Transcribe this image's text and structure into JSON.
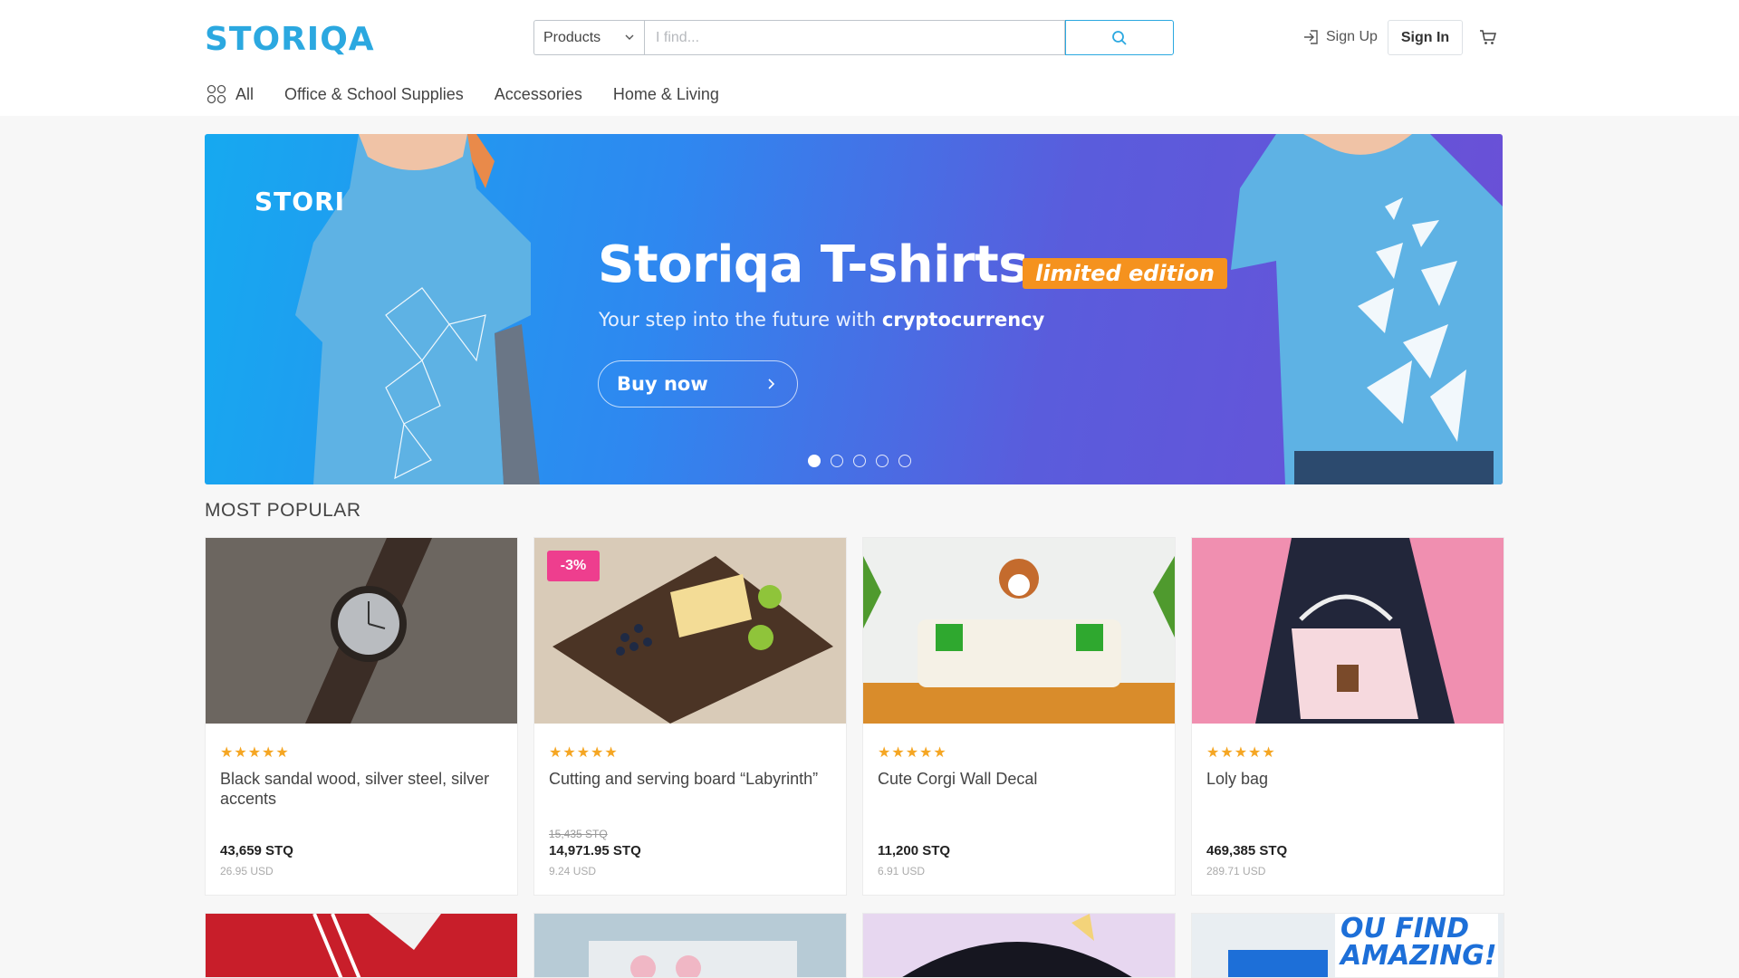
{
  "header": {
    "logo": "STORIQA",
    "search_category": "Products",
    "search_placeholder": "I find...",
    "signup_label": "Sign Up",
    "signin_label": "Sign In"
  },
  "nav": {
    "items": [
      {
        "label": "All"
      },
      {
        "label": "Office & School Supplies"
      },
      {
        "label": "Accessories"
      },
      {
        "label": "Home & Living"
      }
    ]
  },
  "banner": {
    "logo": "STORI",
    "title": "Storiqa T-shirts",
    "badge": "limited edition",
    "subtitle_prefix": "Your step into the future with ",
    "subtitle_bold": "cryptocurrency",
    "button_label": "Buy now",
    "slide_count": 5,
    "active_slide": 1
  },
  "section_title": "MOST POPULAR",
  "products": [
    {
      "title": "Black sandal wood, silver steel, silver accents",
      "stars": "★★★★★",
      "old_price": "",
      "price": "43,659 STQ",
      "usd": "26.95 USD",
      "discount": ""
    },
    {
      "title": "Cutting and serving board “Labyrinth”",
      "stars": "★★★★★",
      "old_price": "15,435 STQ",
      "price": "14,971.95 STQ",
      "usd": "9.24 USD",
      "discount": "-3%"
    },
    {
      "title": "Cute Corgi Wall Decal",
      "stars": "★★★★★",
      "old_price": "",
      "price": "11,200 STQ",
      "usd": "6.91 USD",
      "discount": ""
    },
    {
      "title": "Loly bag",
      "stars": "★★★★★",
      "old_price": "",
      "price": "469,385 STQ",
      "usd": "289.71 USD",
      "discount": ""
    }
  ],
  "row2_text": "OU FIND AMAZING!",
  "colors": {
    "accent": "#2ba8e0",
    "badge": "#f5921e",
    "discount": "#ee3e8e",
    "star": "#f5a623"
  },
  "icons": [
    "search-icon",
    "chevron-down-icon",
    "sign-up-icon",
    "cart-icon",
    "grid-icon",
    "chevron-right-icon"
  ]
}
